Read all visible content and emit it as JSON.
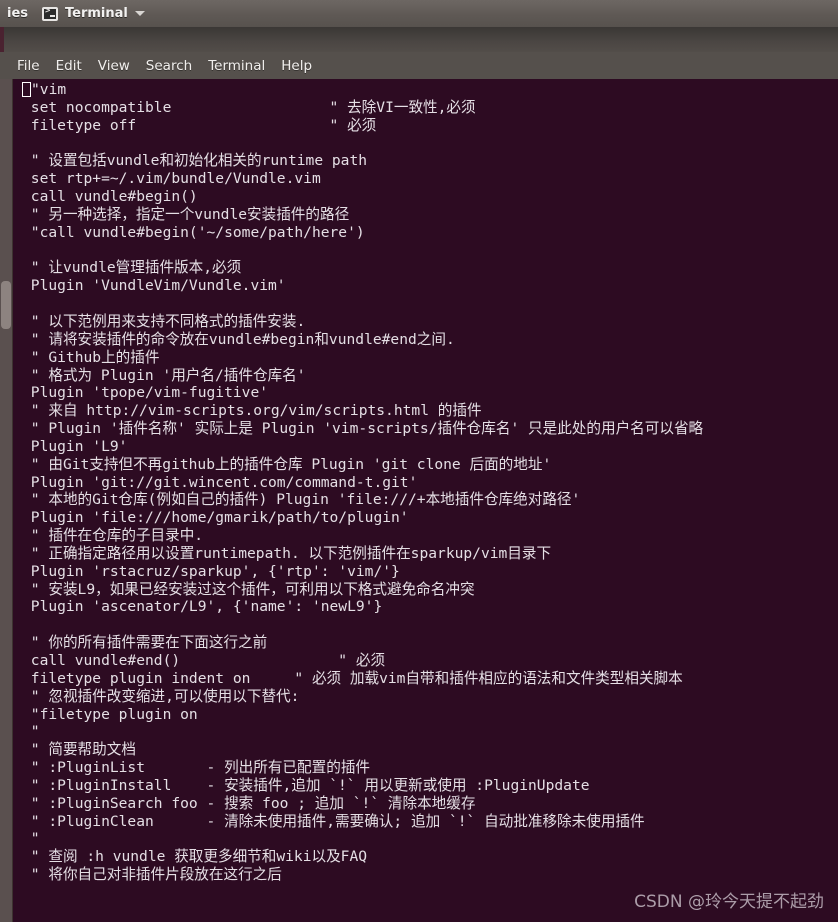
{
  "panel": {
    "truncated_app_label": "ies",
    "app_icon": "terminal-icon",
    "title": "Terminal",
    "caret_icon": "chevron-down-icon"
  },
  "menubar": {
    "items": [
      {
        "label": "File"
      },
      {
        "label": "Edit"
      },
      {
        "label": "View"
      },
      {
        "label": "Search"
      },
      {
        "label": "Terminal"
      },
      {
        "label": "Help"
      }
    ]
  },
  "terminal": {
    "background_color": "#2d0b22",
    "foreground_color": "#e5dfe5",
    "cursor": "block-cursor",
    "scrollbar": {
      "position": "left",
      "thumb_top_fraction": 0.24
    },
    "lines": [
      "\"vim",
      " set nocompatible                  \" 去除VI一致性,必须",
      " filetype off                      \" 必须",
      "",
      " \" 设置包括vundle和初始化相关的runtime path",
      " set rtp+=~/.vim/bundle/Vundle.vim",
      " call vundle#begin()",
      " \" 另一种选择，指定一个vundle安装插件的路径",
      " \"call vundle#begin('~/some/path/here')",
      "",
      " \" 让vundle管理插件版本,必须",
      " Plugin 'VundleVim/Vundle.vim'",
      "",
      " \" 以下范例用来支持不同格式的插件安装.",
      " \" 请将安装插件的命令放在vundle#begin和vundle#end之间.",
      " \" Github上的插件",
      " \" 格式为 Plugin '用户名/插件仓库名'",
      " Plugin 'tpope/vim-fugitive'",
      " \" 来自 http://vim-scripts.org/vim/scripts.html 的插件",
      " \" Plugin '插件名称' 实际上是 Plugin 'vim-scripts/插件仓库名' 只是此处的用户名可以省略",
      " Plugin 'L9'",
      " \" 由Git支持但不再github上的插件仓库 Plugin 'git clone 后面的地址'",
      " Plugin 'git://git.wincent.com/command-t.git'",
      " \" 本地的Git仓库(例如自己的插件) Plugin 'file:///+本地插件仓库绝对路径'",
      " Plugin 'file:///home/gmarik/path/to/plugin'",
      " \" 插件在仓库的子目录中.",
      " \" 正确指定路径用以设置runtimepath. 以下范例插件在sparkup/vim目录下",
      " Plugin 'rstacruz/sparkup', {'rtp': 'vim/'}",
      " \" 安装L9，如果已经安装过这个插件，可利用以下格式避免命名冲突",
      " Plugin 'ascenator/L9', {'name': 'newL9'}",
      "",
      " \" 你的所有插件需要在下面这行之前",
      " call vundle#end()                  \" 必须",
      " filetype plugin indent on     \" 必须 加载vim自带和插件相应的语法和文件类型相关脚本",
      " \" 忽视插件改变缩进,可以使用以下替代:",
      " \"filetype plugin on",
      " \"",
      " \" 简要帮助文档",
      " \" :PluginList       - 列出所有已配置的插件",
      " \" :PluginInstall    - 安装插件,追加 `!` 用以更新或使用 :PluginUpdate",
      " \" :PluginSearch foo - 搜索 foo ; 追加 `!` 清除本地缓存",
      " \" :PluginClean      - 清除未使用插件,需要确认; 追加 `!` 自动批准移除未使用插件",
      " \"",
      " \" 查阅 :h vundle 获取更多细节和wiki以及FAQ",
      " \" 将你自己对非插件片段放在这行之后"
    ]
  },
  "watermark": {
    "text": "CSDN @玲今天提不起劲"
  }
}
